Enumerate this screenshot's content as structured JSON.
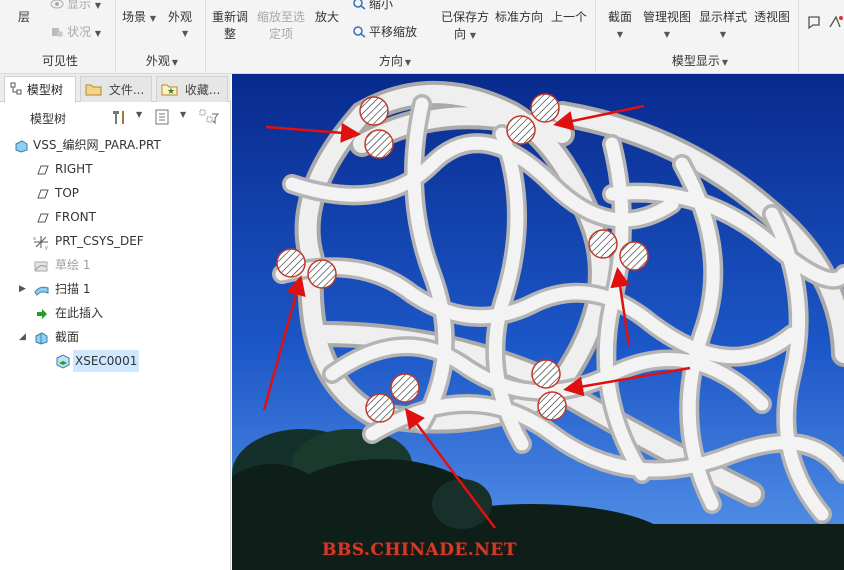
{
  "ribbon": {
    "visibility": {
      "layer_label": "层",
      "show_label": "显示",
      "status_label": "状况",
      "group_title": "可见性"
    },
    "appearance": {
      "scene_label": "场景",
      "appearance_label": "外观",
      "group_title": "外观"
    },
    "orientation": {
      "refit_label_1": "重新调",
      "refit_label_2": "整",
      "zoom_to_selected_1": "缩放至选",
      "zoom_to_selected_2": "定项",
      "zoom_in_label": "放大",
      "zoom_out_label": "缩小",
      "pan_zoom_label": "平移缩放",
      "saved_orientations_1": "已保存方",
      "saved_orientations_2": "向",
      "standard_orientation_label": "标准方向",
      "previous_label": "上一个",
      "group_title": "方向"
    },
    "model_display": {
      "section_label": "截面",
      "manage_views_label": "管理视图",
      "display_style_label": "显示样式",
      "perspective_label": "透视图",
      "group_title": "模型显示"
    }
  },
  "panel": {
    "tabs": [
      "模型树",
      "文件...",
      "收藏..."
    ],
    "toolbar_title": "模型树",
    "tree": [
      {
        "label": "VSS_编织网_PARA.PRT",
        "icon": "part-icon"
      },
      {
        "label": "RIGHT",
        "icon": "datum-plane-icon"
      },
      {
        "label": "TOP",
        "icon": "datum-plane-icon"
      },
      {
        "label": "FRONT",
        "icon": "datum-plane-icon"
      },
      {
        "label": "PRT_CSYS_DEF",
        "icon": "csys-icon"
      },
      {
        "label": "草绘 1",
        "icon": "sketch-icon"
      },
      {
        "label": "扫描 1",
        "icon": "sweep-icon"
      },
      {
        "label": "在此插入",
        "icon": "insert-here-icon"
      },
      {
        "label": "截面",
        "icon": "section-folder-icon"
      },
      {
        "label": "XSEC0001",
        "icon": "xsection-icon"
      }
    ]
  },
  "viewport": {
    "watermark": "BBS.CHINADE.NET"
  },
  "colors": {
    "ribbon_bg": "#f4f4f4",
    "sky_top": "#0a2f9a",
    "sky_bottom": "#4d8de8",
    "annotation_red": "#e01010",
    "selection": "#cde8ff"
  }
}
